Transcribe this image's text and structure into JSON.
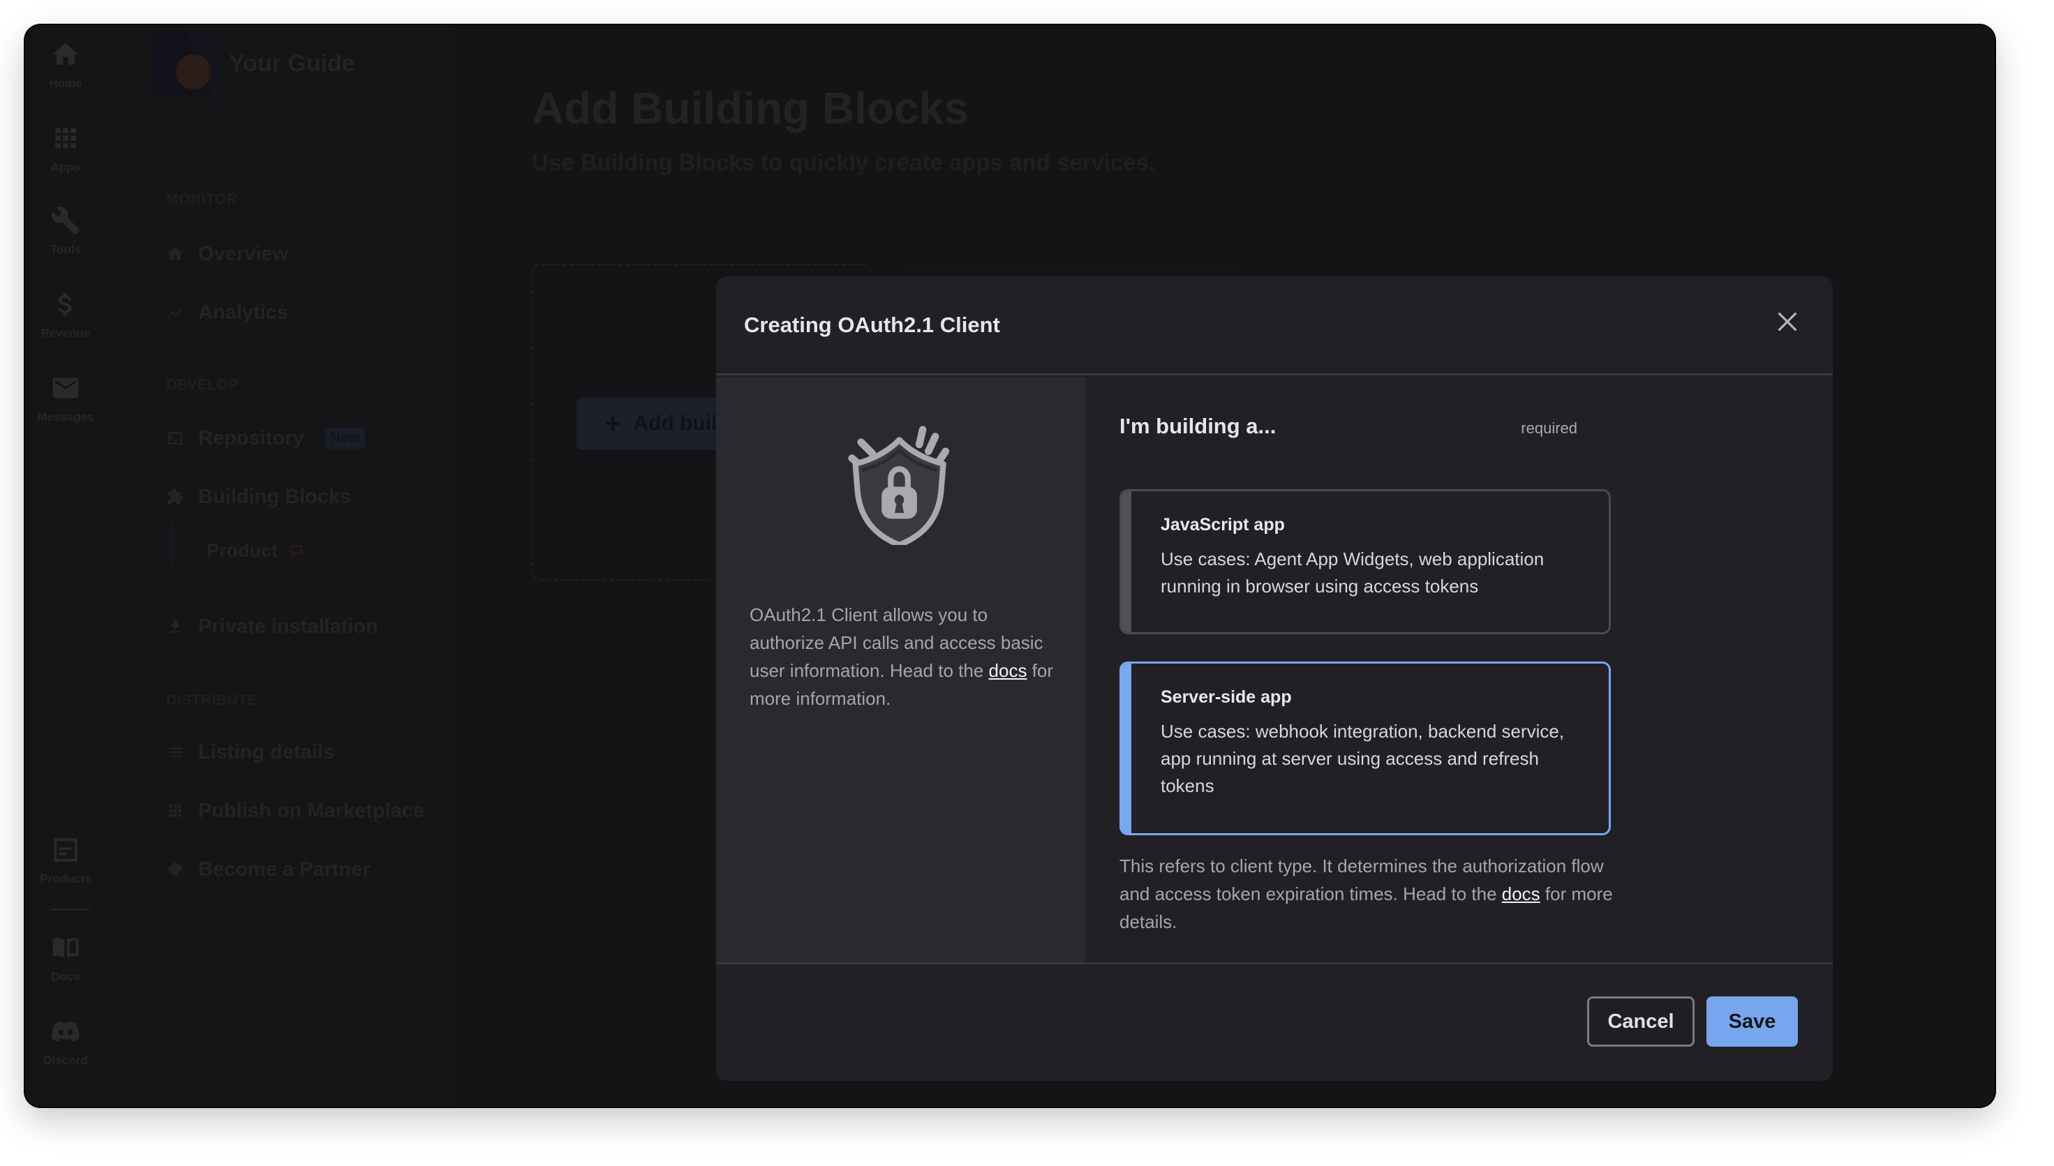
{
  "rail": {
    "items": [
      {
        "label": "Home",
        "icon": "home-icon"
      },
      {
        "label": "Apps",
        "icon": "apps-grid-icon"
      },
      {
        "label": "Tools",
        "icon": "wrench-icon"
      },
      {
        "label": "Revenue",
        "icon": "dollar-icon"
      },
      {
        "label": "Messages",
        "icon": "mail-icon"
      }
    ],
    "bottom_items": [
      {
        "label": "Products",
        "icon": "products-icon"
      },
      {
        "label": "Docs",
        "icon": "book-icon"
      },
      {
        "label": "Discord",
        "icon": "discord-icon"
      }
    ]
  },
  "sidebar": {
    "brand": "Your Guide",
    "sections": {
      "monitor": "MONITOR",
      "develop": "DEVELOP",
      "distribute": "DISTRIBUTE"
    },
    "items": {
      "overview": "Overview",
      "analytics": "Analytics",
      "repository": "Repository",
      "repository_badge": "New",
      "building_blocks": "Building Blocks",
      "product": "Product",
      "private_installation": "Private installation",
      "listing_details": "Listing details",
      "publish": "Publish on Marketplace",
      "partner": "Become a Partner"
    }
  },
  "page": {
    "title": "Add Building Blocks",
    "subtitle": "Use Building Blocks to quickly create apps and services.",
    "add_button_label": "Add building block"
  },
  "dialog": {
    "title": "Creating OAuth2.1 Client",
    "intro_text_before_link": "OAuth2.1 Client allows you to authorize API calls and access basic user information. Head to the ",
    "intro_link": "docs",
    "intro_text_after_link": " for more information.",
    "field_label": "I'm building a...",
    "field_required": "required",
    "options": [
      {
        "title": "JavaScript app",
        "description": "Use cases: Agent App Widgets, web application running in browser using access tokens",
        "selected": false
      },
      {
        "title": "Server-side app",
        "description": "Use cases: webhook integration, backend service, app running at server using access and refresh tokens",
        "selected": true
      }
    ],
    "help_text_before_link": "This refers to client type. It determines the authorization flow and access token expiration times. Head to the ",
    "help_link": "docs",
    "help_text_after_link": " for more details.",
    "cancel_label": "Cancel",
    "save_label": "Save",
    "accent_color": "#7aa7ee"
  }
}
